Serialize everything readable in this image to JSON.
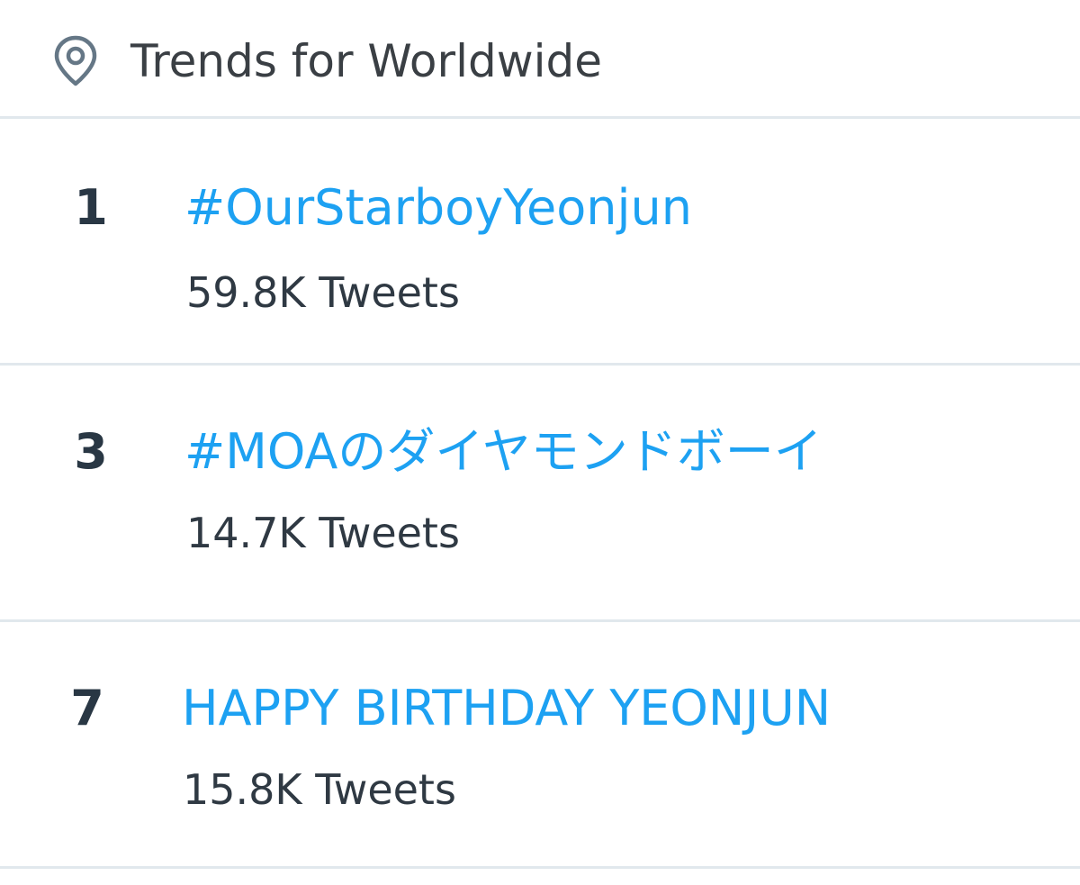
{
  "header": {
    "title": "Trends for Worldwide",
    "icon": "location-pin-icon"
  },
  "colors": {
    "trend_link": "#1da1f2",
    "rank_text": "#293744",
    "count_text": "#2f3943",
    "divider": "#e1e8ed"
  },
  "trends": [
    {
      "rank": "1",
      "name": "#OurStarboyYeonjun",
      "count": "59.8K Tweets"
    },
    {
      "rank": "3",
      "name": "#MOAのダイヤモンドボーイ",
      "count": "14.7K Tweets"
    },
    {
      "rank": "7",
      "name": "HAPPY BIRTHDAY YEONJUN",
      "count": "15.8K Tweets"
    }
  ]
}
